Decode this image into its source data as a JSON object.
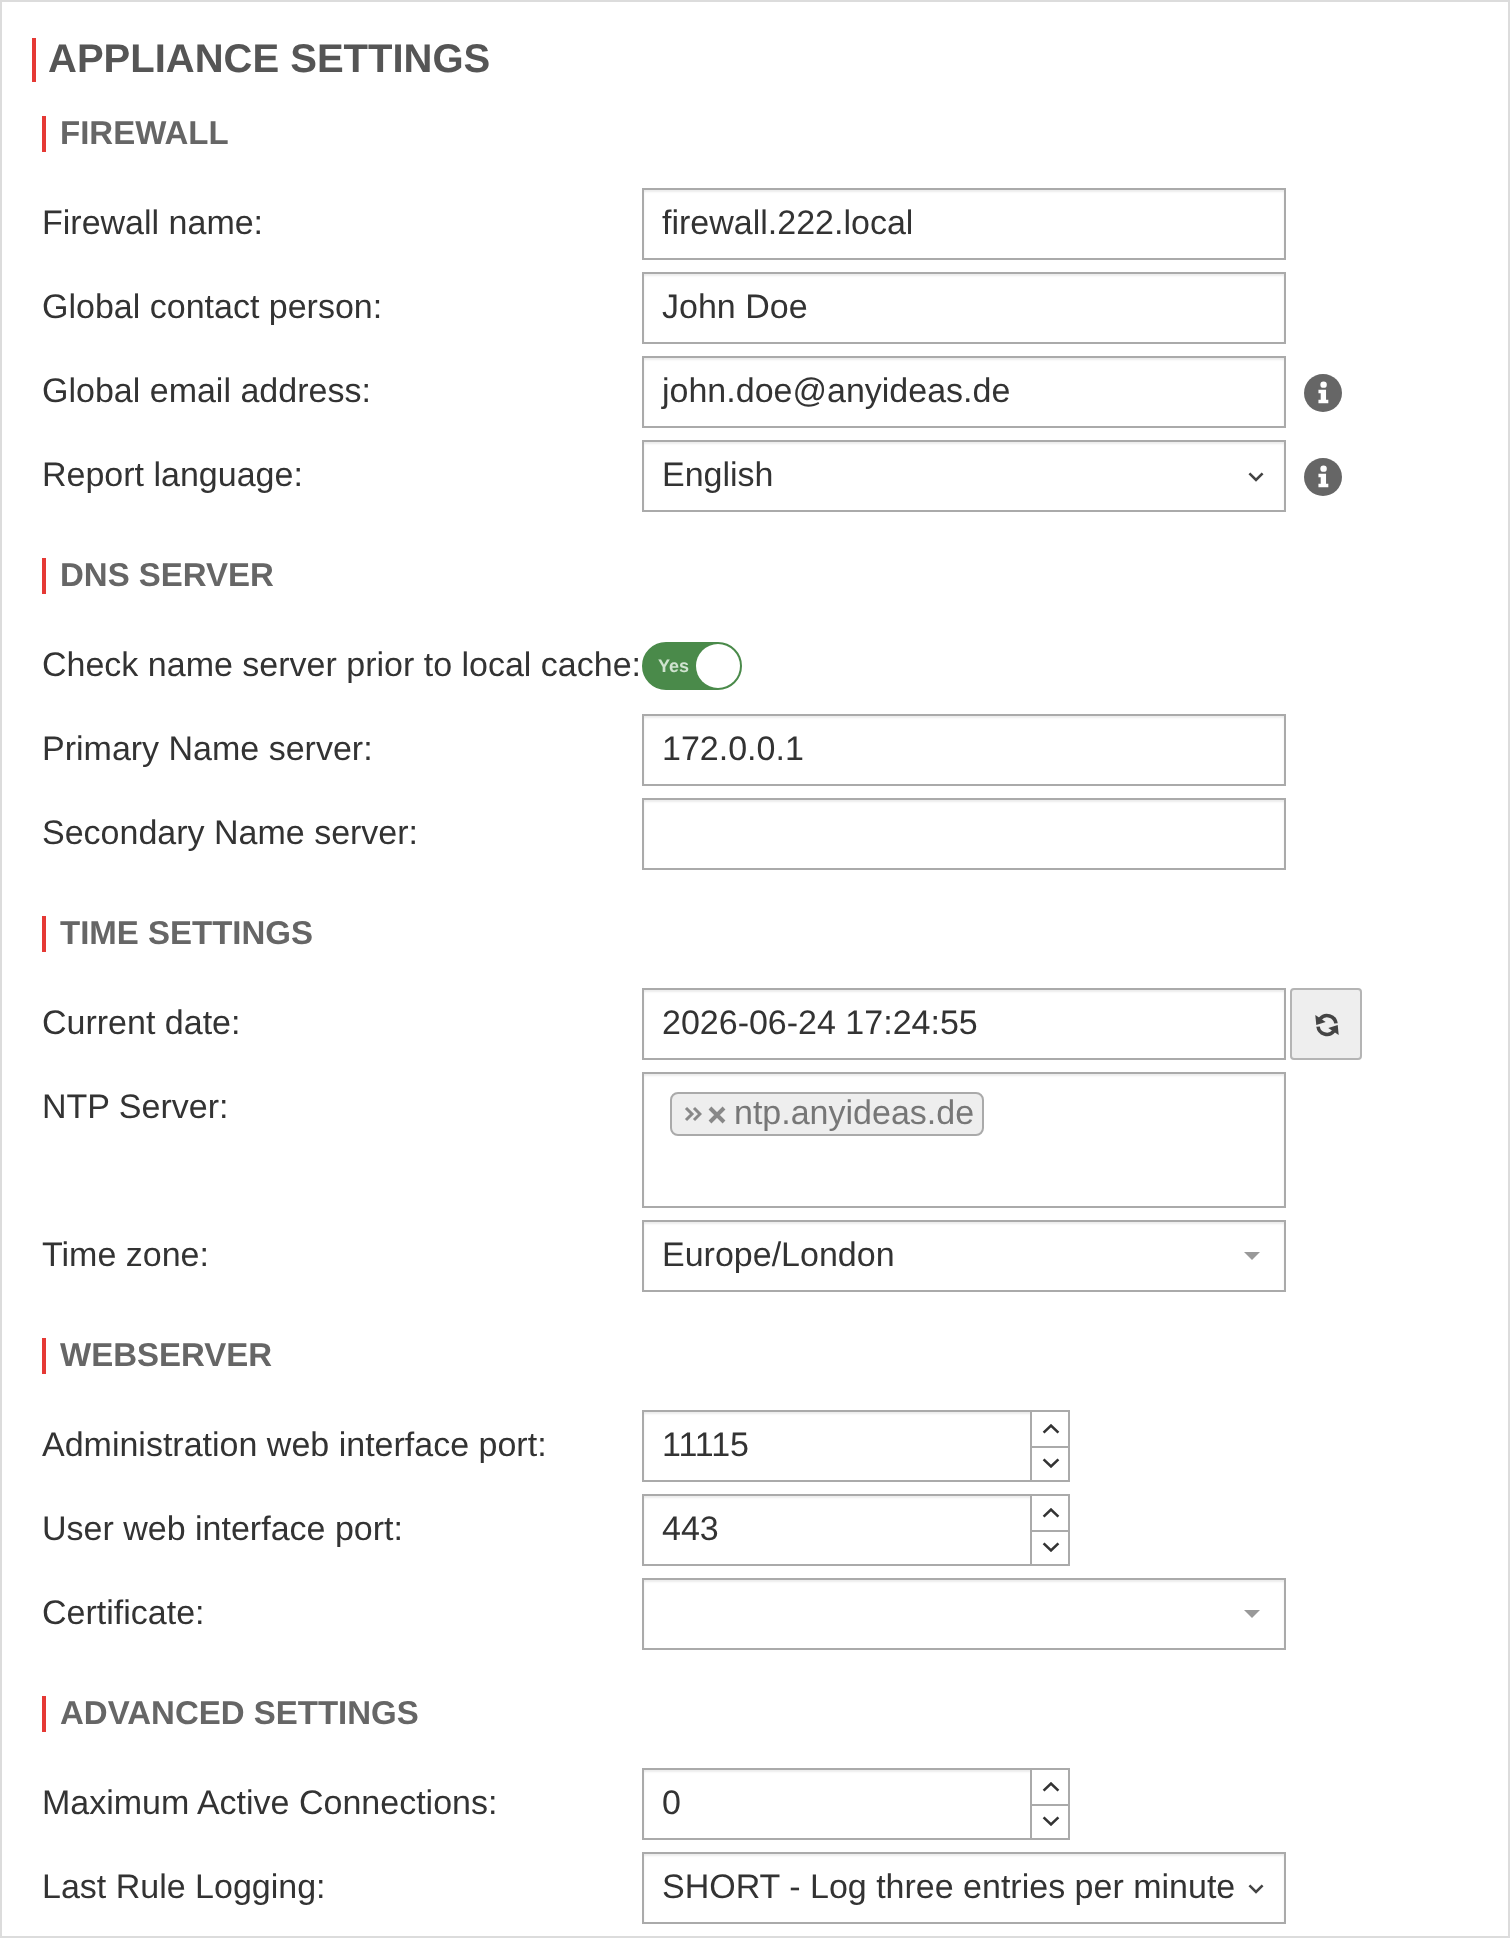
{
  "title": "APPLIANCE SETTINGS",
  "sections": [
    {
      "heading": "FIREWALL",
      "rows": [
        {
          "kind": "text",
          "label": "Firewall name:",
          "value": "firewall.222.local"
        },
        {
          "kind": "text",
          "label": "Global contact person:",
          "value": "John Doe"
        },
        {
          "kind": "text",
          "label": "Global email address:",
          "value": "john.doe@anyideas.de",
          "info": true
        },
        {
          "kind": "select",
          "label": "Report language:",
          "value": "English",
          "info": true
        }
      ]
    },
    {
      "heading": "DNS SERVER",
      "rows": [
        {
          "kind": "toggle",
          "label": "Check name server prior to local cache:",
          "on": true,
          "toggle_text": "Yes"
        },
        {
          "kind": "text",
          "label": "Primary Name server:",
          "value": "172.0.0.1"
        },
        {
          "kind": "text",
          "label": "Secondary Name server:"
        }
      ]
    },
    {
      "heading": "TIME SETTINGS",
      "rows": [
        {
          "kind": "datetime",
          "label": "Current date:",
          "value": "2026-06-24 17:24:55"
        },
        {
          "kind": "tags",
          "label": "NTP Server:",
          "tags": [
            "ntp.anyideas.de"
          ]
        },
        {
          "kind": "combobox",
          "label": "Time zone:",
          "value": "Europe/London"
        }
      ]
    },
    {
      "heading": "WEBSERVER",
      "rows": [
        {
          "kind": "number",
          "label": "Administration web interface port:",
          "value": "11115"
        },
        {
          "kind": "number",
          "label": "User web interface port:",
          "value": "443"
        },
        {
          "kind": "combobox",
          "label": "Certificate:"
        }
      ]
    },
    {
      "heading": "ADVANCED SETTINGS",
      "rows": [
        {
          "kind": "number",
          "label": "Maximum Active Connections:",
          "value": "0"
        },
        {
          "kind": "select",
          "label": "Last Rule Logging:",
          "value": "SHORT - Log three entries per minute"
        }
      ]
    }
  ]
}
